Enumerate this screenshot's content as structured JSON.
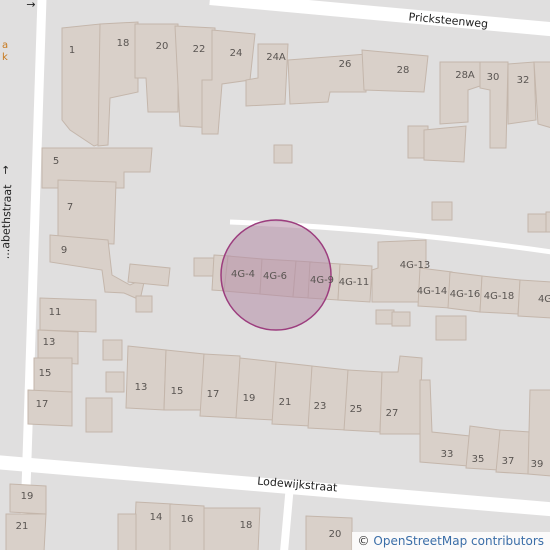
{
  "map": {
    "colors": {
      "background": "#e0dfdf",
      "building_fill": "#d9d0c9",
      "building_stroke": "#c4b6ab",
      "road": "#ffffff",
      "marker_fill": "#b48ca6",
      "marker_stroke": "#9c3d7e"
    },
    "streets": {
      "pricksteenweg": "Pricksteenweg",
      "lodewijkstraat": "Lodewijkstraat",
      "left_street": "...abethstraat"
    },
    "labels": {
      "n1": "1",
      "n18": "18",
      "n20": "20",
      "n22": "22",
      "n24": "24",
      "n24a": "24A",
      "n26": "26",
      "n28": "28",
      "n28a": "28A",
      "n30": "30",
      "n32": "32",
      "n5": "5",
      "n7": "7",
      "n9": "9",
      "n11": "11",
      "n13l": "13",
      "n15l": "15",
      "n17l": "17",
      "g4": "4G-4",
      "g6": "4G-6",
      "g9": "4G-9",
      "g11": "4G-11",
      "g13": "4G-13",
      "g14": "4G-14",
      "g16": "4G-16",
      "g18": "4G-18",
      "g2x": "4G",
      "b13": "13",
      "b15": "15",
      "b17": "17",
      "b19": "19",
      "b21": "21",
      "b23": "23",
      "b25": "25",
      "b27": "27",
      "b33": "33",
      "b35": "35",
      "b37": "37",
      "b39": "39",
      "s19": "19",
      "s21": "21",
      "s14": "14",
      "s16": "16",
      "s18": "18",
      "s20": "20"
    },
    "partial_poi_text": "a\nk",
    "attribution": {
      "copyright": "©",
      "text": "OpenStreetMap contributors"
    }
  }
}
